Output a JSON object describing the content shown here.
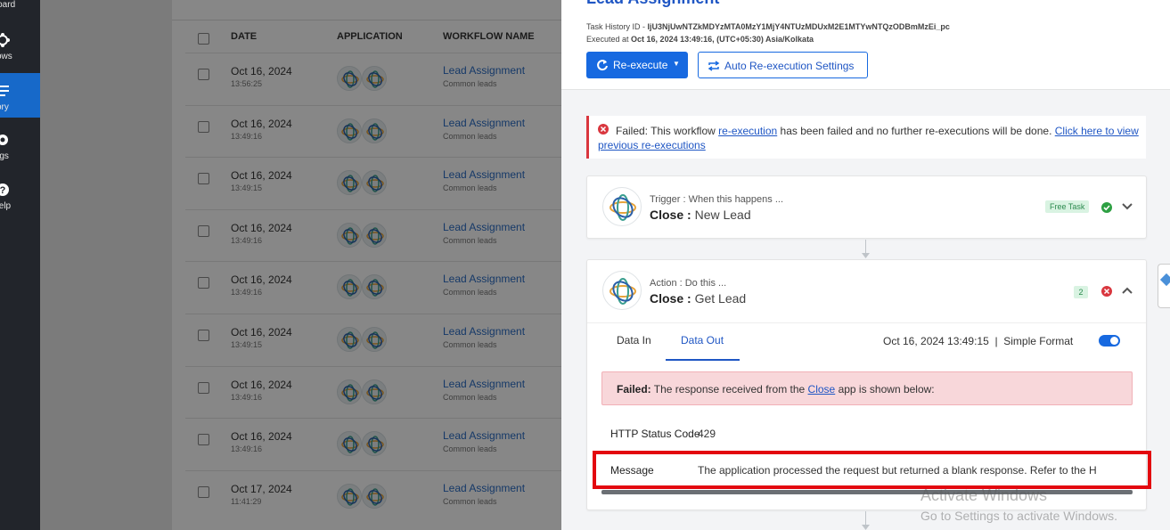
{
  "sidebar": {
    "items": [
      {
        "label": "nboard",
        "icon": "dashboard-icon"
      },
      {
        "label": "kflows",
        "icon": "workflows-icon"
      },
      {
        "label": "istory",
        "icon": "history-icon",
        "active": true
      },
      {
        "label": "ttings",
        "icon": "gear-icon"
      },
      {
        "label": "t Help",
        "icon": "help-icon"
      }
    ]
  },
  "history_list": {
    "headers": {
      "date": "DATE",
      "application": "APPLICATION",
      "workflow": "WORKFLOW NAME"
    },
    "rows": [
      {
        "date": "Oct 16, 2024",
        "time": "13:56:25",
        "workflow": "Lead Assignment",
        "sub": "Common leads"
      },
      {
        "date": "Oct 16, 2024",
        "time": "13:49:16",
        "workflow": "Lead Assignment",
        "sub": "Common leads"
      },
      {
        "date": "Oct 16, 2024",
        "time": "13:49:15",
        "workflow": "Lead Assignment",
        "sub": "Common leads"
      },
      {
        "date": "Oct 16, 2024",
        "time": "13:49:16",
        "workflow": "Lead Assignment",
        "sub": "Common leads"
      },
      {
        "date": "Oct 16, 2024",
        "time": "13:49:16",
        "workflow": "Lead Assignment",
        "sub": "Common leads"
      },
      {
        "date": "Oct 16, 2024",
        "time": "13:49:15",
        "workflow": "Lead Assignment",
        "sub": "Common leads"
      },
      {
        "date": "Oct 16, 2024",
        "time": "13:49:16",
        "workflow": "Lead Assignment",
        "sub": "Common leads"
      },
      {
        "date": "Oct 16, 2024",
        "time": "13:49:16",
        "workflow": "Lead Assignment",
        "sub": "Common leads"
      },
      {
        "date": "Oct 17, 2024",
        "time": "11:41:29",
        "workflow": "Lead Assignment",
        "sub": "Common leads"
      }
    ]
  },
  "panel": {
    "title": "Lead Assignment",
    "task_id_label": "Task History ID - ",
    "task_id": "IjU3NjUwNTZkMDYzMTA0MzY1MjY4NTUzMDUxM2E1MTYwNTQzODBmMzEi_pc",
    "executed_label": "Executed at ",
    "executed_at": "Oct 16, 2024 13:49:16, (UTC+05:30) Asia/Kolkata",
    "reexecute_label": "Re-execute",
    "auto_reexec_label": "Auto Re-execution Settings",
    "alert": {
      "prefix": "Failed: This workflow ",
      "link1": "re-execution",
      "middle": " has been failed and no further re-executions will be done. ",
      "link2": "Click here to view previous re-executions"
    },
    "trigger": {
      "kind": "Trigger : When this happens ...",
      "app": "Close",
      "sep": " : ",
      "event": "New Lead",
      "badge": "Free Task"
    },
    "action": {
      "kind": "Action : Do this ...",
      "app": "Close",
      "sep": " : ",
      "event": "Get Lead",
      "badge": "2",
      "tabs": [
        "Data In",
        "Data Out"
      ],
      "timestamp": "Oct 16, 2024 13:49:15",
      "divider": "|",
      "simple_format_label": "Simple Format",
      "failed_bold": "Failed:",
      "failed_text_1": " The response received from the ",
      "failed_link": "Close",
      "failed_text_2": " app is shown below:",
      "fields": [
        {
          "label": "HTTP Status Code",
          "value": "429"
        },
        {
          "label": "Message",
          "value": "The application processed the request but returned a blank response. Refer to the H"
        }
      ]
    }
  },
  "watermark": {
    "line1": "Activate Windows",
    "line2": "Go to Settings to activate Windows."
  },
  "colors": {
    "brand_blue": "#1769e0",
    "error_red": "#d9363e",
    "success_green": "#2c8a4f",
    "highlight_red": "#e3070f"
  }
}
